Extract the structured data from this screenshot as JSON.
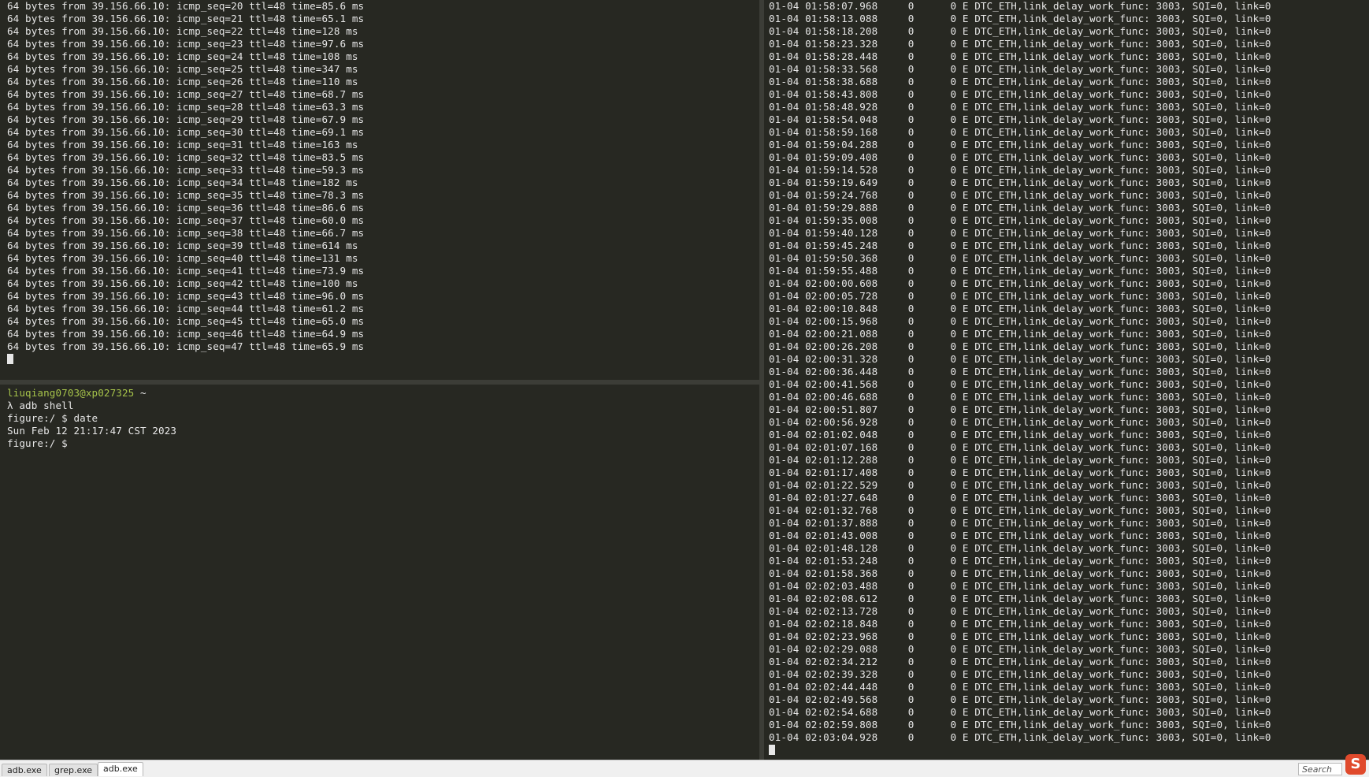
{
  "ping_pane": {
    "lines": [
      "64 bytes from 39.156.66.10: icmp_seq=20 ttl=48 time=85.6 ms",
      "64 bytes from 39.156.66.10: icmp_seq=21 ttl=48 time=65.1 ms",
      "64 bytes from 39.156.66.10: icmp_seq=22 ttl=48 time=128 ms",
      "64 bytes from 39.156.66.10: icmp_seq=23 ttl=48 time=97.6 ms",
      "64 bytes from 39.156.66.10: icmp_seq=24 ttl=48 time=108 ms",
      "64 bytes from 39.156.66.10: icmp_seq=25 ttl=48 time=347 ms",
      "64 bytes from 39.156.66.10: icmp_seq=26 ttl=48 time=110 ms",
      "64 bytes from 39.156.66.10: icmp_seq=27 ttl=48 time=68.7 ms",
      "64 bytes from 39.156.66.10: icmp_seq=28 ttl=48 time=63.3 ms",
      "64 bytes from 39.156.66.10: icmp_seq=29 ttl=48 time=67.9 ms",
      "64 bytes from 39.156.66.10: icmp_seq=30 ttl=48 time=69.1 ms",
      "64 bytes from 39.156.66.10: icmp_seq=31 ttl=48 time=163 ms",
      "64 bytes from 39.156.66.10: icmp_seq=32 ttl=48 time=83.5 ms",
      "64 bytes from 39.156.66.10: icmp_seq=33 ttl=48 time=59.3 ms",
      "64 bytes from 39.156.66.10: icmp_seq=34 ttl=48 time=182 ms",
      "64 bytes from 39.156.66.10: icmp_seq=35 ttl=48 time=78.3 ms",
      "64 bytes from 39.156.66.10: icmp_seq=36 ttl=48 time=86.6 ms",
      "64 bytes from 39.156.66.10: icmp_seq=37 ttl=48 time=60.0 ms",
      "64 bytes from 39.156.66.10: icmp_seq=38 ttl=48 time=66.7 ms",
      "64 bytes from 39.156.66.10: icmp_seq=39 ttl=48 time=614 ms",
      "64 bytes from 39.156.66.10: icmp_seq=40 ttl=48 time=131 ms",
      "64 bytes from 39.156.66.10: icmp_seq=41 ttl=48 time=73.9 ms",
      "64 bytes from 39.156.66.10: icmp_seq=42 ttl=48 time=100 ms",
      "64 bytes from 39.156.66.10: icmp_seq=43 ttl=48 time=96.0 ms",
      "64 bytes from 39.156.66.10: icmp_seq=44 ttl=48 time=61.2 ms",
      "64 bytes from 39.156.66.10: icmp_seq=45 ttl=48 time=65.0 ms",
      "64 bytes from 39.156.66.10: icmp_seq=46 ttl=48 time=64.9 ms",
      "64 bytes from 39.156.66.10: icmp_seq=47 ttl=48 time=65.9 ms"
    ]
  },
  "shell_pane": {
    "user_host": "liuqiang0703@xp027325",
    "cwd": " ~",
    "lines": [
      "λ adb shell",
      "figure:/ $ date",
      "Sun Feb 12 21:17:47 CST 2023",
      "figure:/ $"
    ]
  },
  "log_pane": {
    "columns": {
      "pid": "0",
      "tid": "0",
      "level": "E"
    },
    "message": "DTC_ETH,link_delay_work_func: 3003, SQI=0, link=0",
    "timestamps": [
      "01-04 01:58:07.968",
      "01-04 01:58:13.088",
      "01-04 01:58:18.208",
      "01-04 01:58:23.328",
      "01-04 01:58:28.448",
      "01-04 01:58:33.568",
      "01-04 01:58:38.688",
      "01-04 01:58:43.808",
      "01-04 01:58:48.928",
      "01-04 01:58:54.048",
      "01-04 01:58:59.168",
      "01-04 01:59:04.288",
      "01-04 01:59:09.408",
      "01-04 01:59:14.528",
      "01-04 01:59:19.649",
      "01-04 01:59:24.768",
      "01-04 01:59:29.888",
      "01-04 01:59:35.008",
      "01-04 01:59:40.128",
      "01-04 01:59:45.248",
      "01-04 01:59:50.368",
      "01-04 01:59:55.488",
      "01-04 02:00:00.608",
      "01-04 02:00:05.728",
      "01-04 02:00:10.848",
      "01-04 02:00:15.968",
      "01-04 02:00:21.088",
      "01-04 02:00:26.208",
      "01-04 02:00:31.328",
      "01-04 02:00:36.448",
      "01-04 02:00:41.568",
      "01-04 02:00:46.688",
      "01-04 02:00:51.807",
      "01-04 02:00:56.928",
      "01-04 02:01:02.048",
      "01-04 02:01:07.168",
      "01-04 02:01:12.288",
      "01-04 02:01:17.408",
      "01-04 02:01:22.529",
      "01-04 02:01:27.648",
      "01-04 02:01:32.768",
      "01-04 02:01:37.888",
      "01-04 02:01:43.008",
      "01-04 02:01:48.128",
      "01-04 02:01:53.248",
      "01-04 02:01:58.368",
      "01-04 02:02:03.488",
      "01-04 02:02:08.612",
      "01-04 02:02:13.728",
      "01-04 02:02:18.848",
      "01-04 02:02:23.968",
      "01-04 02:02:29.088",
      "01-04 02:02:34.212",
      "01-04 02:02:39.328",
      "01-04 02:02:44.448",
      "01-04 02:02:49.568",
      "01-04 02:02:54.688",
      "01-04 02:02:59.808",
      "01-04 02:03:04.928"
    ]
  },
  "tabs": [
    {
      "label": "adb.exe",
      "active": false
    },
    {
      "label": "grep.exe",
      "active": false
    },
    {
      "label": "adb.exe",
      "active": true
    }
  ],
  "search": {
    "placeholder": "Search"
  },
  "ime_logo": {
    "glyph": "S",
    "icon": "sogou-ime-icon"
  },
  "colors": {
    "background": "#272822",
    "text": "#e6e6e6",
    "prompt_user": "#a6c34a"
  }
}
